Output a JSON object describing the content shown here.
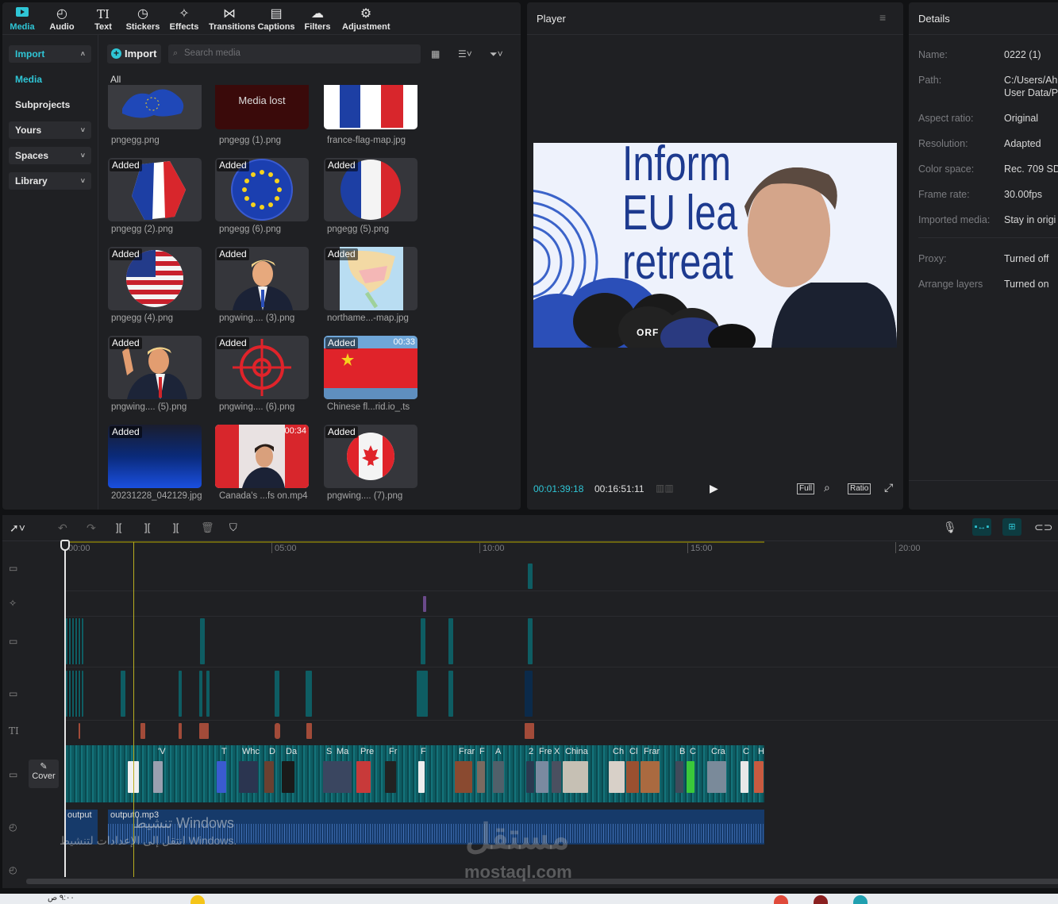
{
  "toolbar": {
    "items": [
      {
        "label": "Media",
        "icon": "media-icon",
        "active": true
      },
      {
        "label": "Audio",
        "icon": "audio-icon"
      },
      {
        "label": "Text",
        "icon": "text-icon"
      },
      {
        "label": "Stickers",
        "icon": "stickers-icon"
      },
      {
        "label": "Effects",
        "icon": "effects-icon"
      },
      {
        "label": "Transitions",
        "icon": "transitions-icon"
      },
      {
        "label": "Captions",
        "icon": "captions-icon"
      },
      {
        "label": "Filters",
        "icon": "filters-icon"
      },
      {
        "label": "Adjustment",
        "icon": "adjustment-icon"
      }
    ]
  },
  "sidebar": {
    "import_label": "Import",
    "media_label": "Media",
    "subprojects_label": "Subprojects",
    "yours_label": "Yours",
    "spaces_label": "Spaces",
    "library_label": "Library"
  },
  "media": {
    "import_button": "Import",
    "search_placeholder": "Search media",
    "filter_all": "All",
    "added_badge": "Added",
    "lost_text": "Media lost",
    "items": [
      {
        "name": "pngegg.png",
        "badge": false
      },
      {
        "name": "pngegg (1).png",
        "badge": false,
        "lost": true
      },
      {
        "name": "france-flag-map.jpg",
        "badge": false
      },
      {
        "name": "pngegg (2).png",
        "badge": true
      },
      {
        "name": "pngegg (6).png",
        "badge": true
      },
      {
        "name": "pngegg (5).png",
        "badge": true
      },
      {
        "name": "pngegg (4).png",
        "badge": true
      },
      {
        "name": "pngwing.... (3).png",
        "badge": true
      },
      {
        "name": "northame...-map.jpg",
        "badge": true
      },
      {
        "name": "pngwing.... (5).png",
        "badge": true
      },
      {
        "name": "pngwing.... (6).png",
        "badge": true
      },
      {
        "name": "Chinese fl...rid.io_.ts",
        "badge": true,
        "duration": "00:33"
      },
      {
        "name": "20231228_042129.jpg",
        "badge": true
      },
      {
        "name": "Canada's ...fs on.mp4",
        "badge": false,
        "duration": "00:34"
      },
      {
        "name": "pngwing.... (7).png",
        "badge": true
      }
    ]
  },
  "player": {
    "title": "Player",
    "current_time": "00:01:39:18",
    "total_time": "00:16:51:11",
    "full_label": "Full",
    "ratio_label": "Ratio",
    "video_text_lines": [
      "Inform",
      "EU lea",
      "retreat"
    ],
    "mic_text": "ORF"
  },
  "details": {
    "title": "Details",
    "rows": [
      {
        "key": "Name:",
        "value": "0222 (1)"
      },
      {
        "key": "Path:",
        "value": "C:/Users/Ah",
        "value2": "User Data/P"
      },
      {
        "key": "Aspect ratio:",
        "value": "Original"
      },
      {
        "key": "Resolution:",
        "value": "Adapted"
      },
      {
        "key": "Color space:",
        "value": "Rec. 709 SD"
      },
      {
        "key": "Frame rate:",
        "value": "30.00fps"
      },
      {
        "key": "Imported media:",
        "value": "Stay in origi"
      },
      {
        "key": "Proxy:",
        "value": "Turned off"
      },
      {
        "key": "Arrange layers",
        "value": "Turned on"
      }
    ]
  },
  "timeline": {
    "ruler": [
      "00:00",
      "05:00",
      "10:00",
      "15:00",
      "20:00"
    ],
    "cover_label": "Cover",
    "audio_clips": [
      "output",
      "output0.mp3"
    ],
    "video_clip_labels": [
      "'V",
      "T",
      "Whc",
      "D",
      "Da",
      "S",
      "Ma",
      "Pre",
      "Fr",
      "F",
      "Frar",
      "F",
      "A",
      "2",
      "Fre",
      "X",
      "China",
      "Ch",
      "Cl",
      "Frar",
      "B",
      "C",
      "Cra",
      "C",
      "H"
    ]
  },
  "overlay": {
    "watermark_ar": "تنشيط Windows",
    "watermark_ar2": "انتقل إلى الإعدادات لتنشيط Windows.",
    "brand_ar": "مستقل",
    "brand_url": "mostaql.com"
  },
  "taskbar": {
    "time": "٩:٠٠ ص"
  }
}
